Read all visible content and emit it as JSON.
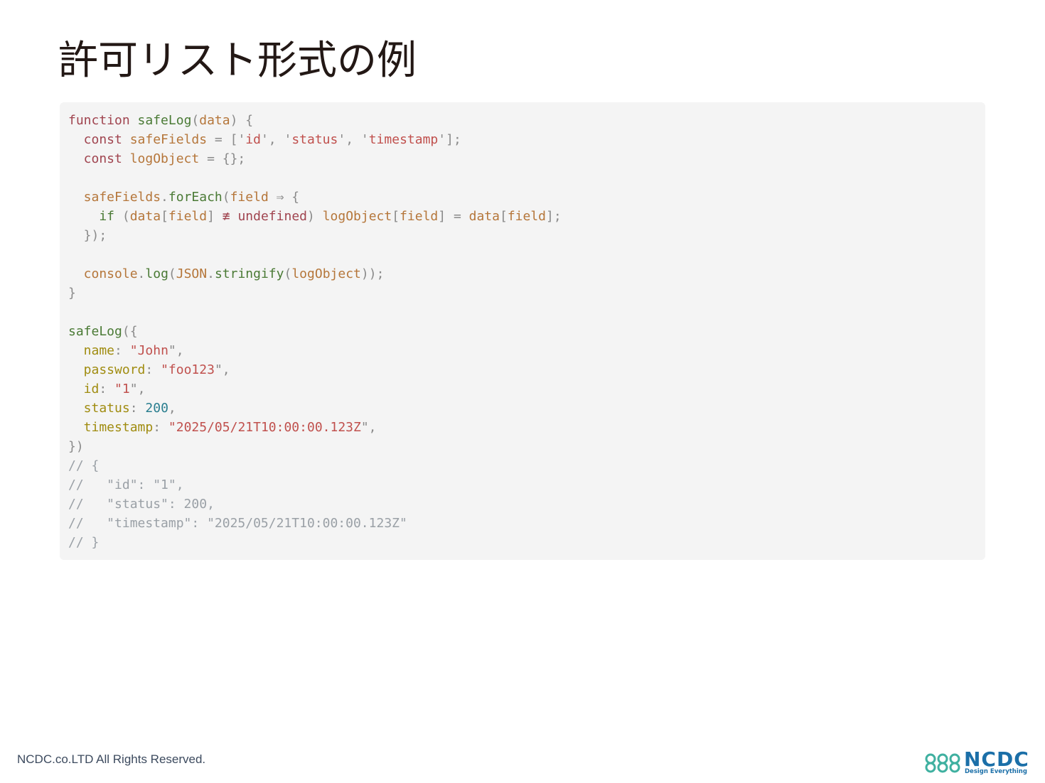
{
  "slide": {
    "title": "許可リスト形式の例",
    "footer": "NCDC.co.LTD All Rights Reserved.",
    "logo": {
      "name": "NCDC",
      "tagline": "Design Everything",
      "color": "#1b6fa8",
      "accent": "#3fb0a0"
    }
  },
  "code": {
    "language": "javascript",
    "lines": [
      [
        {
          "t": "function ",
          "c": "kw"
        },
        {
          "t": "safeLog",
          "c": "fn"
        },
        {
          "t": "(",
          "c": "pun"
        },
        {
          "t": "data",
          "c": "prm"
        },
        {
          "t": ") {",
          "c": "pun"
        }
      ],
      [
        {
          "t": "  const ",
          "c": "kw"
        },
        {
          "t": "safeFields",
          "c": "prm"
        },
        {
          "t": " = [",
          "c": "pun"
        },
        {
          "t": "'",
          "c": "pun"
        },
        {
          "t": "id",
          "c": "str"
        },
        {
          "t": "', ",
          "c": "pun"
        },
        {
          "t": "'",
          "c": "pun"
        },
        {
          "t": "status",
          "c": "str"
        },
        {
          "t": "', ",
          "c": "pun"
        },
        {
          "t": "'",
          "c": "pun"
        },
        {
          "t": "timestamp",
          "c": "str"
        },
        {
          "t": "'];",
          "c": "pun"
        }
      ],
      [
        {
          "t": "  const ",
          "c": "kw"
        },
        {
          "t": "logObject",
          "c": "prm"
        },
        {
          "t": " = {};",
          "c": "pun"
        }
      ],
      [],
      [
        {
          "t": "  safeFields",
          "c": "prm"
        },
        {
          "t": ".",
          "c": "pun"
        },
        {
          "t": "forEach",
          "c": "fn"
        },
        {
          "t": "(",
          "c": "pun"
        },
        {
          "t": "field",
          "c": "prm"
        },
        {
          "t": " ⇒ {",
          "c": "pun"
        }
      ],
      [
        {
          "t": "    if ",
          "c": "fn"
        },
        {
          "t": "(",
          "c": "pun"
        },
        {
          "t": "data",
          "c": "prm"
        },
        {
          "t": "[",
          "c": "pun"
        },
        {
          "t": "field",
          "c": "prm"
        },
        {
          "t": "] ",
          "c": "pun"
        },
        {
          "t": "≢",
          "c": "kw"
        },
        {
          "t": " undefined",
          "c": "kw"
        },
        {
          "t": ") ",
          "c": "pun"
        },
        {
          "t": "logObject",
          "c": "prm"
        },
        {
          "t": "[",
          "c": "pun"
        },
        {
          "t": "field",
          "c": "prm"
        },
        {
          "t": "] = ",
          "c": "pun"
        },
        {
          "t": "data",
          "c": "prm"
        },
        {
          "t": "[",
          "c": "pun"
        },
        {
          "t": "field",
          "c": "prm"
        },
        {
          "t": "];",
          "c": "pun"
        }
      ],
      [
        {
          "t": "  });",
          "c": "pun"
        }
      ],
      [],
      [
        {
          "t": "  console",
          "c": "prm"
        },
        {
          "t": ".",
          "c": "pun"
        },
        {
          "t": "log",
          "c": "fn"
        },
        {
          "t": "(",
          "c": "pun"
        },
        {
          "t": "JSON",
          "c": "prm"
        },
        {
          "t": ".",
          "c": "pun"
        },
        {
          "t": "stringify",
          "c": "fn"
        },
        {
          "t": "(",
          "c": "pun"
        },
        {
          "t": "logObject",
          "c": "prm"
        },
        {
          "t": "));",
          "c": "pun"
        }
      ],
      [
        {
          "t": "}",
          "c": "pun"
        }
      ],
      [],
      [
        {
          "t": "safeLog",
          "c": "fn"
        },
        {
          "t": "({",
          "c": "pun"
        }
      ],
      [
        {
          "t": "  name",
          "c": "key"
        },
        {
          "t": ": ",
          "c": "pun"
        },
        {
          "t": "\"",
          "c": "str"
        },
        {
          "t": "John",
          "c": "str"
        },
        {
          "t": "\",",
          "c": "pun"
        }
      ],
      [
        {
          "t": "  password",
          "c": "key"
        },
        {
          "t": ": ",
          "c": "pun"
        },
        {
          "t": "\"",
          "c": "str"
        },
        {
          "t": "foo123",
          "c": "str"
        },
        {
          "t": "\",",
          "c": "pun"
        }
      ],
      [
        {
          "t": "  id",
          "c": "key"
        },
        {
          "t": ": ",
          "c": "pun"
        },
        {
          "t": "\"",
          "c": "str"
        },
        {
          "t": "1",
          "c": "str"
        },
        {
          "t": "\",",
          "c": "pun"
        }
      ],
      [
        {
          "t": "  status",
          "c": "key"
        },
        {
          "t": ": ",
          "c": "pun"
        },
        {
          "t": "200",
          "c": "num"
        },
        {
          "t": ",",
          "c": "pun"
        }
      ],
      [
        {
          "t": "  timestamp",
          "c": "key"
        },
        {
          "t": ": ",
          "c": "pun"
        },
        {
          "t": "\"",
          "c": "str"
        },
        {
          "t": "2025/05/21T10:00:00.123Z",
          "c": "str"
        },
        {
          "t": "\",",
          "c": "pun"
        }
      ],
      [
        {
          "t": "})",
          "c": "pun"
        }
      ],
      [
        {
          "t": "// {",
          "c": "cmt"
        }
      ],
      [
        {
          "t": "//   \"id\": \"1\",",
          "c": "cmt"
        }
      ],
      [
        {
          "t": "//   \"status\": 200,",
          "c": "cmt"
        }
      ],
      [
        {
          "t": "//   \"timestamp\": \"2025/05/21T10:00:00.123Z\"",
          "c": "cmt"
        }
      ],
      [
        {
          "t": "// }",
          "c": "cmt"
        }
      ]
    ]
  }
}
